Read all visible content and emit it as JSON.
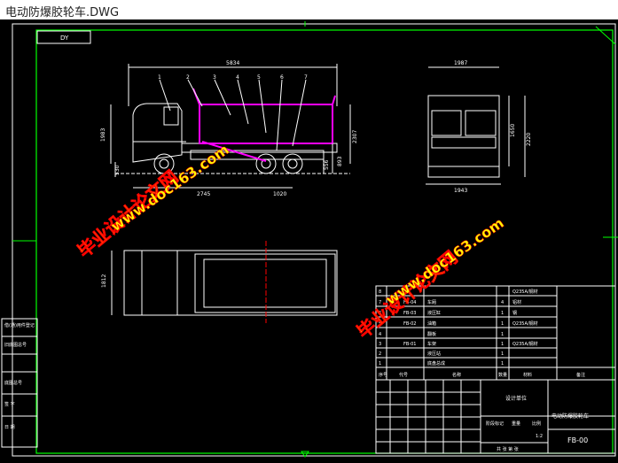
{
  "window": {
    "title": "电动防爆胶轮车.DWG"
  },
  "drawing": {
    "corner_box": "DY",
    "dims": {
      "overall_length": "5834",
      "front_width": "1987",
      "side_height": "1983",
      "bed_height": "2307",
      "front_height": "1650",
      "total_height": "2220",
      "ground": "530",
      "wheelbase_front": "2745",
      "wheelbase_rear": "1020",
      "low1": "556",
      "low2": "893",
      "rear_width": "1943",
      "top_width": "1812"
    },
    "balloons": [
      "1",
      "2",
      "3",
      "4",
      "5",
      "6",
      "7"
    ],
    "watermarks": [
      "毕业设计论文网",
      "www.doc163.com"
    ],
    "left_labels": [
      "借(通)用件登记",
      "旧底图总号",
      "底图总号",
      "签 字",
      "日 期"
    ],
    "bom_rows": [
      [
        "8",
        "",
        "",
        "",
        "Q235A/钢材",
        ""
      ],
      [
        "7",
        "FB-04",
        "车厢",
        "4",
        "铝材",
        ""
      ],
      [
        "6",
        "FB-03",
        "液压缸",
        "1",
        "钢",
        ""
      ],
      [
        "5",
        "FB-02",
        "油箱",
        "1",
        "Q235A/钢材",
        ""
      ],
      [
        "4",
        "",
        "翻板",
        "1",
        "",
        ""
      ],
      [
        "3",
        "FB-01",
        "车架",
        "1",
        "Q235A/钢材",
        ""
      ],
      [
        "2",
        "",
        "液压站",
        "1",
        "",
        ""
      ],
      [
        "1",
        "",
        "底盘总成",
        "1",
        "",
        ""
      ]
    ],
    "bom_header": [
      "序号",
      "代号",
      "名称",
      "数量",
      "材料",
      "备注"
    ],
    "title_block": {
      "org": "设计单位",
      "product": "电动防爆胶轮车",
      "drawing_no": "FB-00",
      "scale": "1:2",
      "sheet_info": "共 张 第 张",
      "stage": "阶段标记",
      "weight": "重量",
      "ratio": "比例"
    }
  }
}
